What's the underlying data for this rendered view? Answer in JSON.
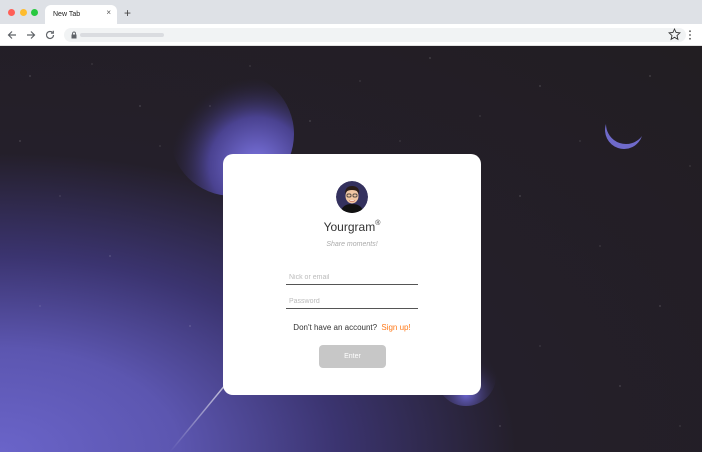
{
  "browser": {
    "tab_title": "New Tab",
    "tab_close": "×",
    "new_tab": "+"
  },
  "login": {
    "brand": "Yourgram",
    "brand_mark": "®",
    "tagline": "Share moments!",
    "nick_placeholder": "Nick or email",
    "password_placeholder": "Password",
    "signup_prompt": "Don't have an account?",
    "signup_link": "Sign up!",
    "enter_label": "Enter"
  },
  "colors": {
    "accent": "#ff7a1a",
    "button_disabled": "#c7c7c7",
    "background_dark": "#221e22",
    "background_glow": "#6a64c9"
  }
}
